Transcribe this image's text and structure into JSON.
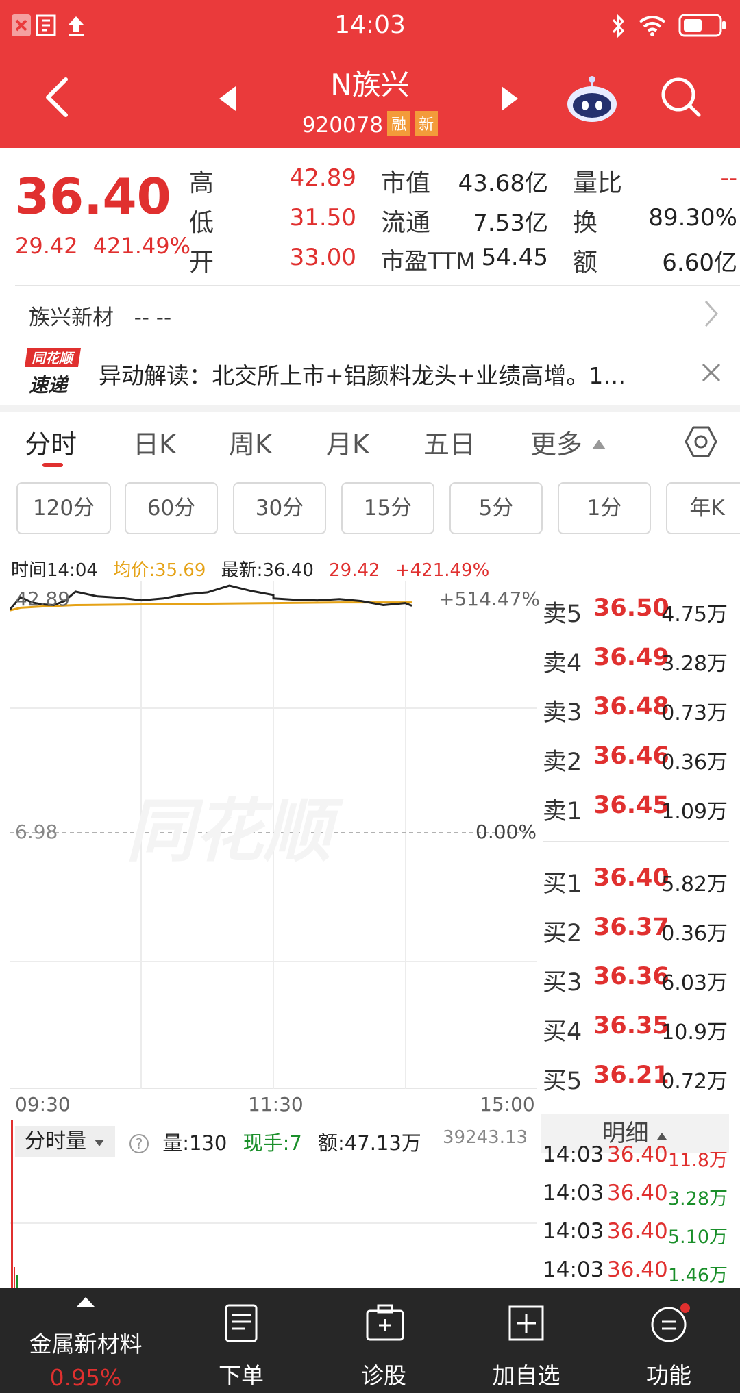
{
  "status_bar": {
    "time": "14:03"
  },
  "header": {
    "title": "N族兴",
    "code": "920078",
    "tags": [
      "融",
      "新"
    ]
  },
  "quote": {
    "price": "36.40",
    "change": "29.42",
    "change_pct": "421.49%",
    "fields": [
      {
        "label": "高",
        "value": "42.89"
      },
      {
        "label": "低",
        "value": "31.50"
      },
      {
        "label": "开",
        "value": "33.00"
      },
      {
        "label": "市值",
        "value": "43.68亿"
      },
      {
        "label": "流通",
        "value": "7.53亿"
      },
      {
        "label": "市盈TTM",
        "value": "54.45"
      },
      {
        "label": "量比",
        "value": "--"
      },
      {
        "label": "换",
        "value": "89.30%"
      },
      {
        "label": "额",
        "value": "6.60亿"
      }
    ]
  },
  "industry": {
    "label": "族兴新材",
    "value": "-- --"
  },
  "news": {
    "logo_top": "同花顺",
    "logo_bottom": "速递",
    "text": "异动解读：北交所上市+铝颜料龙头+业绩高增。1…"
  },
  "tabs": [
    "分时",
    "日K",
    "周K",
    "月K",
    "五日",
    "更多"
  ],
  "periods": [
    "120分",
    "60分",
    "30分",
    "15分",
    "5分",
    "1分",
    "年K"
  ],
  "info_bar": {
    "time": "时间14:04",
    "avg": "均价:35.69",
    "latest": "最新:36.40",
    "change": "29.42",
    "change_pct": "+421.49%"
  },
  "chart": {
    "high_label": "42.89",
    "high_pct": "+514.47%",
    "base_label": "6.98",
    "base_pct": "0.00%",
    "watermark": "同花顺",
    "time_labels": [
      "09:30",
      "11:30",
      "15:00"
    ]
  },
  "chart_data": {
    "type": "line",
    "series": [
      {
        "name": "价格",
        "x": [
          "09:30",
          "09:35",
          "09:40",
          "09:45",
          "09:50",
          "09:55",
          "10:00",
          "10:10",
          "10:20",
          "10:30",
          "10:40",
          "10:50",
          "11:00",
          "11:10",
          "11:20",
          "11:30",
          "13:00",
          "13:10",
          "13:20",
          "13:30",
          "13:40",
          "13:50",
          "14:00",
          "14:03"
        ],
        "values": [
          40.2,
          42.1,
          41.3,
          41.0,
          40.9,
          41.5,
          42.9,
          42.2,
          42.0,
          41.6,
          41.9,
          42.5,
          42.8,
          43.8,
          43.0,
          42.4,
          41.9,
          41.7,
          41.6,
          41.8,
          41.5,
          40.9,
          41.2,
          40.8
        ]
      },
      {
        "name": "均价",
        "x": [
          "09:30",
          "09:35",
          "09:45",
          "10:00",
          "10:30",
          "11:00",
          "11:30",
          "13:30",
          "14:03"
        ],
        "values": [
          40.1,
          40.5,
          40.7,
          40.9,
          41.0,
          41.1,
          41.2,
          41.3,
          41.3
        ]
      }
    ],
    "ylim": [
      6.98,
      42.89
    ]
  },
  "order_book": {
    "asks": [
      {
        "label": "卖5",
        "price": "36.50",
        "vol": "4.75万"
      },
      {
        "label": "卖4",
        "price": "36.49",
        "vol": "3.28万"
      },
      {
        "label": "卖3",
        "price": "36.48",
        "vol": "0.73万"
      },
      {
        "label": "卖2",
        "price": "36.46",
        "vol": "0.36万"
      },
      {
        "label": "卖1",
        "price": "36.45",
        "vol": "1.09万"
      }
    ],
    "bids": [
      {
        "label": "买1",
        "price": "36.40",
        "vol": "5.82万"
      },
      {
        "label": "买2",
        "price": "36.37",
        "vol": "0.36万"
      },
      {
        "label": "买3",
        "price": "36.36",
        "vol": "6.03万"
      },
      {
        "label": "买4",
        "price": "36.35",
        "vol": "10.9万"
      },
      {
        "label": "买5",
        "price": "36.21",
        "vol": "0.72万"
      }
    ]
  },
  "volume": {
    "selector": "分时量",
    "qty": "量:130",
    "hand": "现手:7",
    "amount": "额:47.13万",
    "max": "39243.13"
  },
  "detail": {
    "header": "明细",
    "ticks": [
      {
        "time": "14:03",
        "price": "36.40",
        "vol": "11.8万",
        "color": "#e0302f"
      },
      {
        "time": "14:03",
        "price": "36.40",
        "vol": "3.28万",
        "color": "#1a8f2a"
      },
      {
        "time": "14:03",
        "price": "36.40",
        "vol": "5.10万",
        "color": "#1a8f2a"
      },
      {
        "time": "14:03",
        "price": "36.40",
        "vol": "1.46万",
        "color": "#1a8f2a"
      }
    ]
  },
  "bottom_nav": {
    "sector": "金属新材料",
    "sector_pct": "0.95%",
    "items": [
      "下单",
      "诊股",
      "加自选",
      "功能"
    ]
  }
}
